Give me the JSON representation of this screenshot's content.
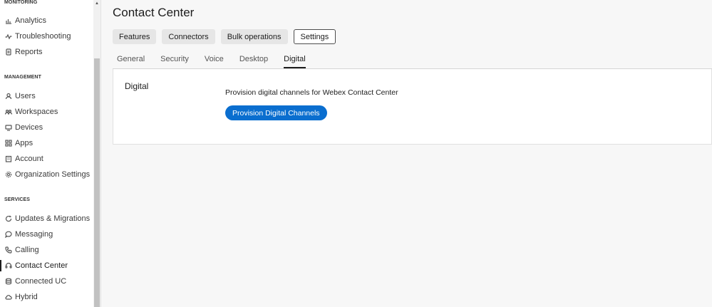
{
  "sidebar": {
    "sections": {
      "monitoring": "MONITORING",
      "management": "MANAGEMENT",
      "services": "SERVICES"
    },
    "monitoring_items": [
      {
        "label": "Analytics",
        "icon": "bar-chart-icon"
      },
      {
        "label": "Troubleshooting",
        "icon": "pulse-icon"
      },
      {
        "label": "Reports",
        "icon": "document-icon"
      }
    ],
    "management_items": [
      {
        "label": "Users",
        "icon": "user-icon"
      },
      {
        "label": "Workspaces",
        "icon": "people-icon"
      },
      {
        "label": "Devices",
        "icon": "device-icon"
      },
      {
        "label": "Apps",
        "icon": "apps-icon"
      },
      {
        "label": "Account",
        "icon": "building-icon"
      },
      {
        "label": "Organization Settings",
        "icon": "gear-icon"
      }
    ],
    "services_items": [
      {
        "label": "Updates & Migrations",
        "icon": "refresh-icon"
      },
      {
        "label": "Messaging",
        "icon": "chat-icon"
      },
      {
        "label": "Calling",
        "icon": "phone-icon"
      },
      {
        "label": "Contact Center",
        "icon": "headset-icon",
        "active": true
      },
      {
        "label": "Connected UC",
        "icon": "stack-icon"
      },
      {
        "label": "Hybrid",
        "icon": "cloud-icon"
      }
    ]
  },
  "main": {
    "title": "Contact Center",
    "pills": [
      "Features",
      "Connectors",
      "Bulk operations",
      "Settings"
    ],
    "selected_pill": "Settings",
    "tabs": [
      "General",
      "Security",
      "Voice",
      "Desktop",
      "Digital"
    ],
    "active_tab": "Digital",
    "card": {
      "title": "Digital",
      "description": "Provision digital channels for Webex Contact Center",
      "button_label": "Provision Digital Channels"
    }
  },
  "colors": {
    "primary_button": "#0a6ecf",
    "text": "#1d1d1d"
  }
}
